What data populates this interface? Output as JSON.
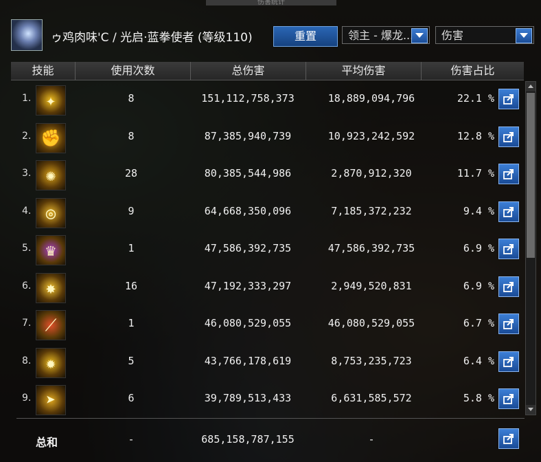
{
  "window": {
    "title": "伤害统计"
  },
  "header": {
    "character": "ゥ鸡肉味'C / 光启·蓝拳使者 (等级110)",
    "reset_label": "重置",
    "boss_select": "领主 - 爆龙...",
    "metric_select": "伤害"
  },
  "table": {
    "columns": [
      "技能",
      "使用次数",
      "总伤害",
      "平均伤害",
      "伤害占比"
    ],
    "rows": [
      {
        "index": "1.",
        "uses": "8",
        "total": "151,112,758,373",
        "avg": "18,889,094,796",
        "pct": "22.1 %",
        "icon": "lightning-claw-icon",
        "icon_color": "#f2c020",
        "glyph": "✦"
      },
      {
        "index": "2.",
        "uses": "8",
        "total": "87,385,940,739",
        "avg": "10,923,242,592",
        "pct": "12.8 %",
        "icon": "fist-icon",
        "icon_color": "#e6b31a",
        "glyph": "✊"
      },
      {
        "index": "3.",
        "uses": "28",
        "total": "80,385,544,986",
        "avg": "2,870,912,320",
        "pct": "11.7 %",
        "icon": "spin-strike-icon",
        "icon_color": "#d9a218",
        "glyph": "✺"
      },
      {
        "index": "4.",
        "uses": "9",
        "total": "64,668,350,096",
        "avg": "7,185,372,232",
        "pct": "9.4 %",
        "icon": "whirlwind-icon",
        "icon_color": "#e3b22a",
        "glyph": "◎"
      },
      {
        "index": "5.",
        "uses": "1",
        "total": "47,586,392,735",
        "avg": "47,586,392,735",
        "pct": "6.9 %",
        "icon": "awakening-icon",
        "icon_color": "#a63cc8",
        "glyph": "♛"
      },
      {
        "index": "6.",
        "uses": "16",
        "total": "47,192,333,297",
        "avg": "2,949,520,831",
        "pct": "6.9 %",
        "icon": "burst-icon",
        "icon_color": "#f0c030",
        "glyph": "✸"
      },
      {
        "index": "7.",
        "uses": "1",
        "total": "46,080,529,055",
        "avg": "46,080,529,055",
        "pct": "6.7 %",
        "icon": "slash-icon",
        "icon_color": "#e0502a",
        "glyph": "⟋"
      },
      {
        "index": "8.",
        "uses": "5",
        "total": "43,766,178,619",
        "avg": "8,753,235,723",
        "pct": "6.4 %",
        "icon": "chain-punch-icon",
        "icon_color": "#e8b820",
        "glyph": "✹"
      },
      {
        "index": "9.",
        "uses": "6",
        "total": "39,789,513,433",
        "avg": "6,631,585,572",
        "pct": "5.8 %",
        "icon": "dash-strike-icon",
        "icon_color": "#e0a820",
        "glyph": "➤"
      }
    ]
  },
  "summary": {
    "label": "总和",
    "uses": "-",
    "total": "685,158,787,155",
    "avg": "-"
  }
}
